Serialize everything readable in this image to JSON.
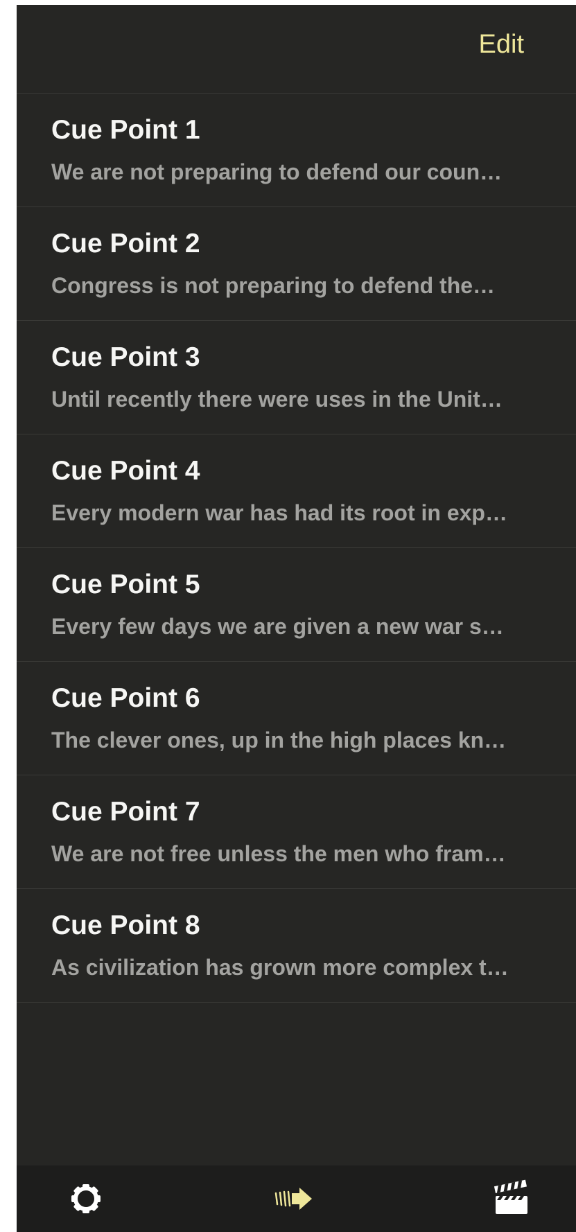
{
  "navbar": {
    "edit_label": "Edit"
  },
  "cues": [
    {
      "title": "Cue Point 1",
      "subtitle": "We are not preparing to defend our coun…"
    },
    {
      "title": "Cue Point 2",
      "subtitle": "Congress is not preparing to defend the…"
    },
    {
      "title": "Cue Point 3",
      "subtitle": "Until recently there were uses in the Unit…"
    },
    {
      "title": "Cue Point 4",
      "subtitle": "Every modern war has had its root in exp…"
    },
    {
      "title": "Cue Point 5",
      "subtitle": "Every few days we are given a new war s…"
    },
    {
      "title": "Cue Point 6",
      "subtitle": "The clever ones, up in the high places kn…"
    },
    {
      "title": "Cue Point 7",
      "subtitle": "We are not free unless the men who fram…"
    },
    {
      "title": "Cue Point 8",
      "subtitle": "As civilization has grown more complex t…"
    }
  ],
  "toolbar": {
    "left_icon": "gear-icon",
    "center_icon": "forward-arrow-icon",
    "right_icon": "clapperboard-icon"
  },
  "colors": {
    "accent": "#efe79a",
    "background": "#262624",
    "toolbar_background": "#1d1d1c",
    "title_text": "#f6f6f4",
    "subtitle_text": "#a3a3a0"
  }
}
